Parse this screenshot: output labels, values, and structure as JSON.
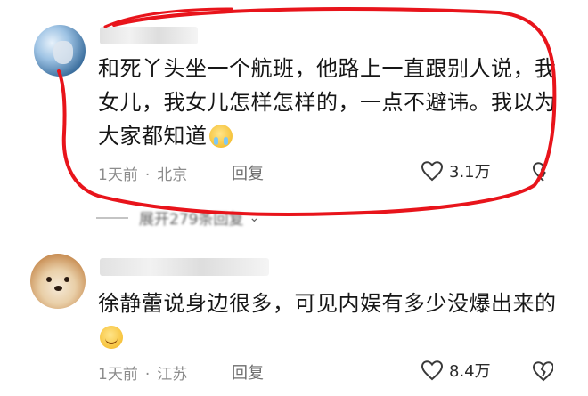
{
  "comments": [
    {
      "text": "和死丫头坐一个航班，他路上一直跟别人说，我女儿，我女儿怎样怎样的，一点不避讳。我以为大家都知道",
      "emoji": "crying-face-emoji",
      "time": "1天前",
      "location": "北京",
      "reply_label": "回复",
      "likes": "3.1万"
    },
    {
      "text": "徐静蕾说身边很多，可见内娱有多少没爆出来的",
      "emoji": "smiling-face-emoji",
      "time": "1天前",
      "location": "江苏",
      "reply_label": "回复",
      "likes": "8.4万"
    }
  ],
  "expand_replies": "展开279条回复",
  "colors": {
    "annotation_red": "#e8141b",
    "meta_gray": "#8c8c8c",
    "text": "#161616"
  }
}
